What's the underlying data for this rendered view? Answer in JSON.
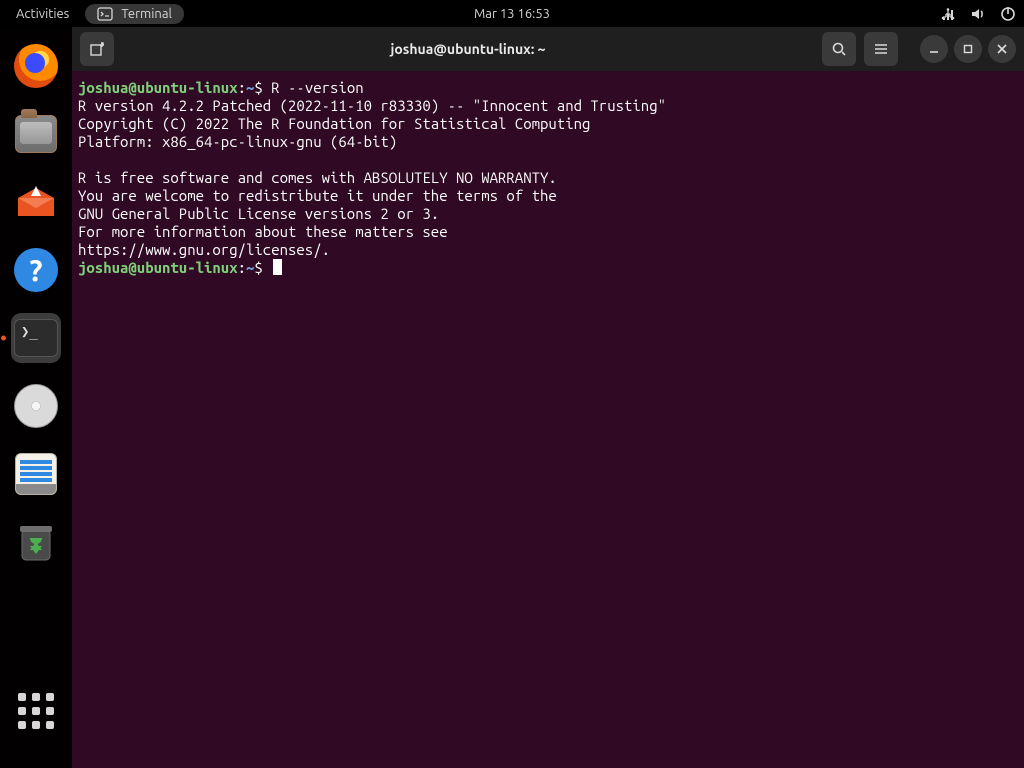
{
  "topbar": {
    "activities_label": "Activities",
    "app_label": "Terminal",
    "datetime": "Mar 13  16:53"
  },
  "dock": {
    "items": [
      {
        "name": "firefox"
      },
      {
        "name": "files"
      },
      {
        "name": "software"
      },
      {
        "name": "help"
      },
      {
        "name": "terminal",
        "active": true
      },
      {
        "name": "disc"
      },
      {
        "name": "text-editor"
      },
      {
        "name": "trash"
      }
    ]
  },
  "window": {
    "title": "joshua@ubuntu-linux: ~"
  },
  "terminal": {
    "prompt_user": "joshua@ubuntu-linux",
    "prompt_sep1": ":",
    "prompt_path": "~",
    "prompt_sep2": "$ ",
    "command1": "R --version",
    "output": "R version 4.2.2 Patched (2022-11-10 r83330) -- \"Innocent and Trusting\"\nCopyright (C) 2022 The R Foundation for Statistical Computing\nPlatform: x86_64-pc-linux-gnu (64-bit)\n\nR is free software and comes with ABSOLUTELY NO WARRANTY.\nYou are welcome to redistribute it under the terms of the\nGNU General Public License versions 2 or 3.\nFor more information about these matters see\nhttps://www.gnu.org/licenses/.\n"
  }
}
